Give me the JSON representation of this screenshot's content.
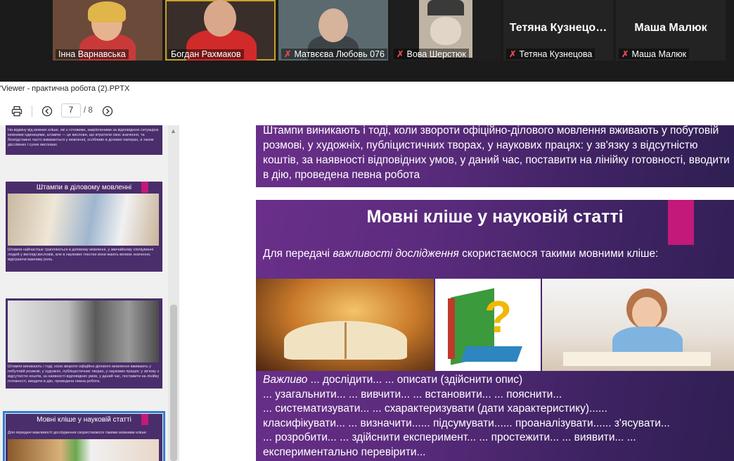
{
  "participants": [
    {
      "name": "Інна Варнавська",
      "muted": false,
      "active": false
    },
    {
      "name": "Богдан Рахмаков",
      "muted": false,
      "active": true
    },
    {
      "name": "Матвєєва Любовь 076",
      "muted": true,
      "active": false
    },
    {
      "name": "Вова Шерстюк",
      "muted": true,
      "active": false
    },
    {
      "name": "Тетяна Кузнецова",
      "display": "Тетяна  Кузнецо…",
      "muted": true,
      "active": false
    },
    {
      "name": "Маша Малюк",
      "display": "Маша Малюк",
      "muted": true,
      "active": false
    }
  ],
  "viewer": {
    "title": "'Viewer - практична робота (2).PPTX",
    "current_page": "7",
    "total_pages": "/ 8"
  },
  "icons": {
    "print": "printer-icon",
    "prev": "prev-page-icon",
    "next": "next-page-icon",
    "muted": "muted-mic-icon"
  },
  "thumbnails": [
    {
      "title": "",
      "body": "На відміну від мовних кліше, які є готовими, закріпленими за відповідною ситуацією мовними одиницями, штампи — це вислови, що втратили своє значення, та безпідставно часто вживаються у мовленні, особливо в ділових паперах, а також дієслівних і сухих висловах."
    },
    {
      "title": "Штампи в діловому мовленні",
      "body": "Штампи найчастіше трапляються в діловому мовленні, у звичайному спілкуванні людей у вигляді висловів, але в наукових текстах вони мають велике значення, відіграючи важливу роль."
    },
    {
      "title": "",
      "body": "Штампи виникають і тоді, коли звороти офіційно-ділового мовлення вживають у побутовій розмові, у художніх, публіцистичних творах, у наукових працях: у зв'язку з відсутністю коштів, за наявності відповідних умов, у даний час, поставити на лінійку готовності, вводити в дію, проведена певна робота."
    },
    {
      "title": "Мовні кліше у науковій статті",
      "body": "Для передачі важливості дослідження скористаємося такими мовними кліше:"
    }
  ],
  "slides": {
    "prev_text": "Штампи виникають і тоді, коли звороти офіційно-ділового мовлення вживають у побутовій розмові, у художніх, публіцистичних творах, у наукових працях: у зв'язку з відсутністю коштів, за наявності відповідних умов, у даний час, поставити на лінійку готовності, вводити в дію, проведена певна робота",
    "current": {
      "heading": "Мовні кліше у науковій статті",
      "intro_before": "Для передачі ",
      "intro_emph": "важливості дослідження",
      "intro_after": " скористаємося такими мовними кліше:",
      "lines": [
        {
          "emph": "Важливо",
          "text": " ... дослідити... ... описати (здійснити опис)"
        },
        {
          "emph": "",
          "text": "... узагальнити... ... вивчити... ... встановити... ... пояснити..."
        },
        {
          "emph": "",
          "text": "... систематизувати... ... схарактеризувати (дати характеристику)......"
        },
        {
          "emph": "",
          "text": "класифікувати...   ... визначити...... підсумувати...... проаналізувати...... з'ясувати..."
        },
        {
          "emph": "",
          "text": "... розробити...   ... здійснити експеримент... ... простежити... ... виявити... ..."
        },
        {
          "emph": "",
          "text": "експериментально перевірити..."
        }
      ]
    }
  },
  "colors": {
    "slide_purple": "#5b2b7d",
    "accent_pink": "#c2197a",
    "strip_bg": "#1b1b1b",
    "mute_red": "#e5484d"
  }
}
